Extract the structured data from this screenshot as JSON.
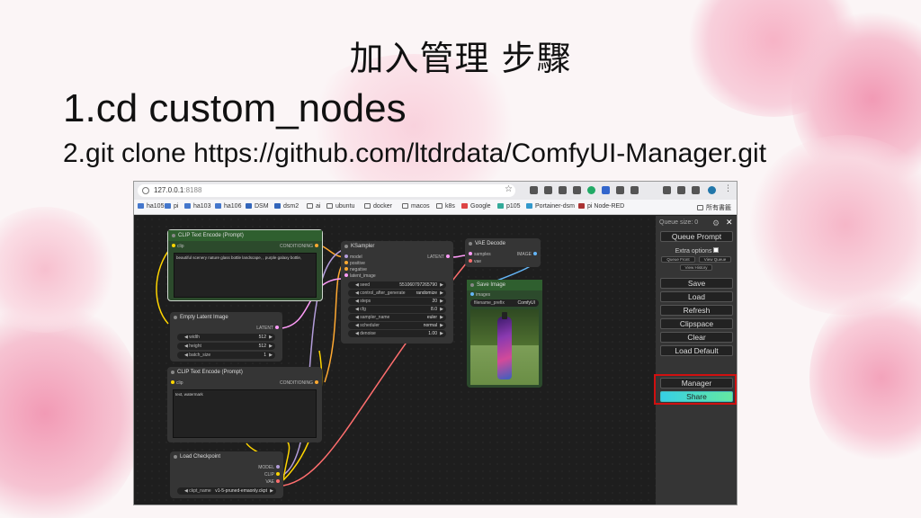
{
  "slide": {
    "title": "加入管理 步驟",
    "step1": "1.cd custom_nodes",
    "step2": "2.git clone https://github.com/ltdrdata/ComfyUI-Manager.git"
  },
  "browser": {
    "url_host": "127.0.0.1",
    "url_port": ":8188",
    "bookmarks": [
      "ha105",
      "pi",
      "ha103",
      "ha106",
      "DSM",
      "dsm2",
      "ai",
      "ubuntu",
      "docker",
      "macos",
      "k8s",
      "Google",
      "p105",
      "Portainer-dsm",
      "pi Node-RED"
    ],
    "all_bookmarks": "所有書籤"
  },
  "nodes": {
    "clip_top": {
      "title": "CLIP Text Encode (Prompt)",
      "in": "clip",
      "out": "CONDITIONING",
      "text": "beautiful scenery nature glass bottle landscape, , purple galaxy bottle,"
    },
    "latent": {
      "title": "Empty Latent Image",
      "out": "LATENT",
      "widgets": [
        [
          "width",
          "512"
        ],
        [
          "height",
          "512"
        ],
        [
          "batch_size",
          "1"
        ]
      ]
    },
    "clip_bottom": {
      "title": "CLIP Text Encode (Prompt)",
      "in": "clip",
      "out": "CONDITIONING",
      "text": "text, watermark"
    },
    "checkpoint": {
      "title": "Load Checkpoint",
      "outs": [
        "MODEL",
        "CLIP",
        "VAE"
      ],
      "ckpt_label": "ckpt_name",
      "ckpt_value": "v1-5-pruned-emaonly.ckpt"
    },
    "ksampler": {
      "title": "KSampler",
      "ins": [
        "model",
        "positive",
        "negative",
        "latent_image"
      ],
      "out": "LATENT",
      "widgets": [
        [
          "seed",
          "551060797265790"
        ],
        [
          "control_after_generate",
          "randomize"
        ],
        [
          "steps",
          "20"
        ],
        [
          "cfg",
          "8.0"
        ],
        [
          "sampler_name",
          "euler"
        ],
        [
          "scheduler",
          "normal"
        ],
        [
          "denoise",
          "1.00"
        ]
      ]
    },
    "vae": {
      "title": "VAE Decode",
      "ins": [
        "samples",
        "vae"
      ],
      "out": "IMAGE"
    },
    "save": {
      "title": "Save Image",
      "in": "images",
      "prefix_label": "filename_prefix",
      "prefix_value": "ComfyUI"
    }
  },
  "panel": {
    "queue_size": "Queue size: 0",
    "queue_prompt": "Queue Prompt",
    "extra_options": "Extra options",
    "queue_front": "Queue Front",
    "view_queue": "View Queue",
    "view_history": "View History",
    "save": "Save",
    "load": "Load",
    "refresh": "Refresh",
    "clipspace": "Clipspace",
    "clear": "Clear",
    "load_default": "Load Default",
    "manager": "Manager",
    "share": "Share"
  },
  "colors": {
    "accent_red": "#d01010",
    "node_green": "#2f5f2f",
    "pink": "#f2a7bf"
  }
}
